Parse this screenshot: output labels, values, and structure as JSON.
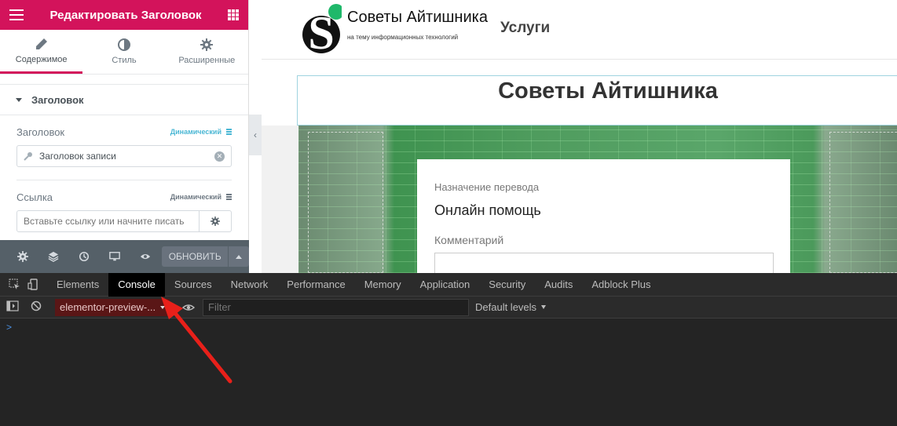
{
  "panel": {
    "title": "Редактировать Заголовок",
    "accent_color": "#d3135b",
    "tabs": [
      {
        "label": "Содержимое",
        "icon": "pencil-icon"
      },
      {
        "label": "Стиль",
        "icon": "contrast-icon"
      },
      {
        "label": "Расширенные",
        "icon": "gear-icon"
      }
    ],
    "section_title": "Заголовок",
    "heading_control": {
      "label": "Заголовок",
      "dynamic_label": "Динамический",
      "tag_value": "Заголовок записи"
    },
    "link_control": {
      "label": "Ссылка",
      "dynamic_label": "Динамический",
      "placeholder": "Вставьте ссылку или начните писать"
    },
    "footer": {
      "update_label": "ОБНОВИТЬ"
    }
  },
  "preview": {
    "logo_title": "Советы Айтишника",
    "logo_subtitle": "на тему информационных технологий",
    "menu_item": "Услуги",
    "heading": "Советы Айтишника",
    "form": {
      "label_purpose": "Назначение перевода",
      "purpose_value": "Онлайн помощь",
      "label_comment": "Комментарий"
    }
  },
  "devtools": {
    "tabs": [
      "Elements",
      "Console",
      "Sources",
      "Network",
      "Performance",
      "Memory",
      "Application",
      "Security",
      "Audits",
      "Adblock Plus"
    ],
    "active_tab": "Console",
    "context": "elementor-preview-...",
    "filter_placeholder": "Filter",
    "levels": "Default levels",
    "prompt": ">"
  },
  "colors": {
    "annotation_arrow": "#e8201a",
    "devtools_bg": "#242424"
  }
}
